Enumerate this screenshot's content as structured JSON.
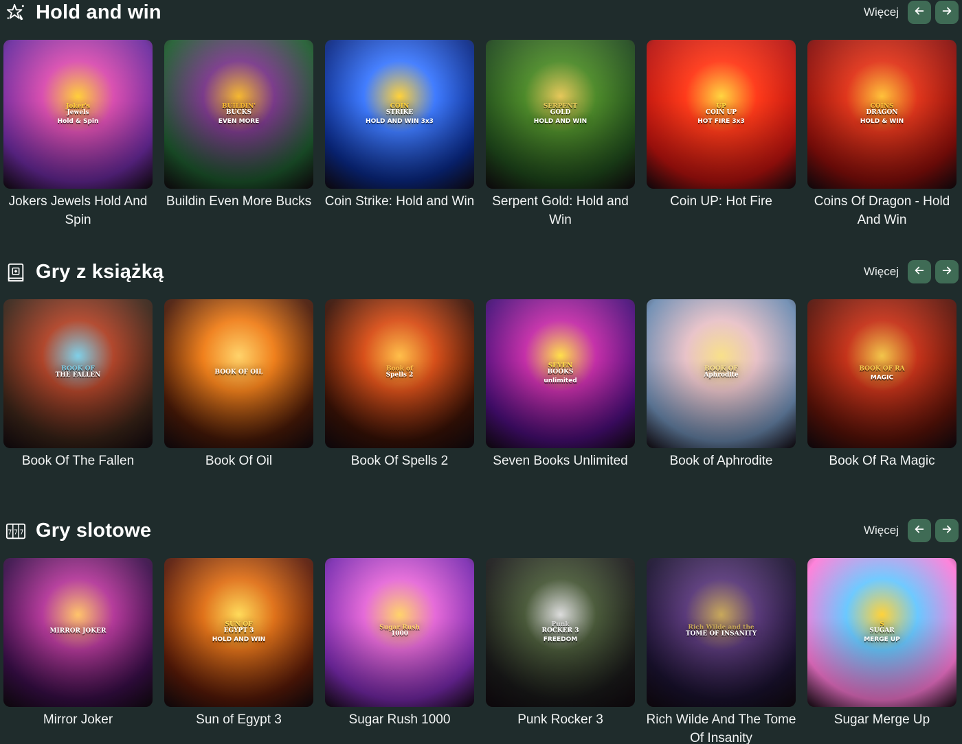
{
  "more_label": "Więcej",
  "sections": [
    {
      "title": "Hold and win",
      "icon": "star-sparkle-icon",
      "games": [
        {
          "title": "Jokers Jewels Hold And Spin",
          "logo": [
            "Joker's",
            "Jewels",
            "Hold & Spin"
          ],
          "colors": [
            "#6a2a9e",
            "#d94fb0",
            "#ffcf3a"
          ]
        },
        {
          "title": "Buildin Even More Bucks",
          "logo": [
            "BUILDIN'",
            "BUCKS",
            "EVEN MORE"
          ],
          "colors": [
            "#1d5a2e",
            "#7a3a8a",
            "#f5b830"
          ]
        },
        {
          "title": "Coin Strike: Hold and Win",
          "logo": [
            "COIN",
            "STRIKE",
            "HOLD AND WIN 3x3"
          ],
          "colors": [
            "#0a2a8a",
            "#3f7bff",
            "#ffd23a"
          ]
        },
        {
          "title": "Serpent Gold: Hold and Win",
          "logo": [
            "SERPENT",
            "GOLD",
            "HOLD AND WIN"
          ],
          "colors": [
            "#1f4a1c",
            "#4d8a2a",
            "#e6c85a"
          ]
        },
        {
          "title": "Coin UP: Hot Fire",
          "logo": [
            "UP",
            "COIN UP",
            "HOT FIRE 3x3"
          ],
          "colors": [
            "#b8120e",
            "#ff3a1a",
            "#ffd640"
          ]
        },
        {
          "title": "Coins Of Dragon - Hold And Win",
          "logo": [
            "COINS",
            "DRAGON",
            "HOLD & WIN"
          ],
          "colors": [
            "#8a0e0a",
            "#e0361c",
            "#ffc23a"
          ]
        }
      ]
    },
    {
      "title": "Gry z książką",
      "icon": "book-icon",
      "games": [
        {
          "title": "Book Of The Fallen",
          "logo": [
            "BOOK OF",
            "THE FALLEN",
            ""
          ],
          "colors": [
            "#3a2418",
            "#b0452a",
            "#7fd0e8"
          ]
        },
        {
          "title": "Book Of Oil",
          "logo": [
            "",
            "BOOK OF OIL",
            ""
          ],
          "colors": [
            "#4a1a08",
            "#f0801c",
            "#ffd36a"
          ]
        },
        {
          "title": "Book Of Spells 2",
          "logo": [
            "Book of",
            "Spells 2",
            ""
          ],
          "colors": [
            "#3a1206",
            "#d8501a",
            "#ffbf4a"
          ]
        },
        {
          "title": "Seven Books Unlimited",
          "logo": [
            "SEVEN",
            "BOOKS",
            "unlimited"
          ],
          "colors": [
            "#4a0e7a",
            "#c42fa8",
            "#ffe04a"
          ]
        },
        {
          "title": "Book of Aphrodite",
          "logo": [
            "BOOK OF",
            "Aphrodite",
            ""
          ],
          "colors": [
            "#6b8ab0",
            "#e8c2c8",
            "#f8e08a"
          ]
        },
        {
          "title": "Book Of Ra Magic",
          "logo": [
            "BOOK OF RA",
            "",
            "MAGIC"
          ],
          "colors": [
            "#5a1208",
            "#c5331a",
            "#f2c54a"
          ]
        }
      ]
    },
    {
      "title": "Gry slotowe",
      "icon": "slot-machine-icon",
      "games": [
        {
          "title": "Mirror Joker",
          "logo": [
            "",
            "MIRROR JOKER",
            ""
          ],
          "colors": [
            "#3a0e4a",
            "#b43a9a",
            "#ffc46a"
          ]
        },
        {
          "title": "Sun of Egypt 3",
          "logo": [
            "SUN OF",
            "EGYPT 3",
            "HOLD AND WIN"
          ],
          "colors": [
            "#5a1a08",
            "#e0721a",
            "#ffdb5a"
          ]
        },
        {
          "title": "Sugar Rush 1000",
          "logo": [
            "Sugar Rush",
            "1000",
            ""
          ],
          "colors": [
            "#7a2ab0",
            "#e56ad8",
            "#ffd36a"
          ]
        },
        {
          "title": "Punk Rocker 3",
          "logo": [
            "Punk",
            "ROCKER 3",
            "FREEDOM"
          ],
          "colors": [
            "#1a1a1a",
            "#4a5a3a",
            "#dcdcdc"
          ]
        },
        {
          "title": "Rich Wilde And The Tome Of Insanity",
          "logo": [
            "Rich Wilde and the",
            "TOME OF INSANITY",
            ""
          ],
          "colors": [
            "#1a1230",
            "#5a3a7a",
            "#c8a85a"
          ]
        },
        {
          "title": "Sugar Merge Up",
          "logo": [
            "S",
            "SUGAR",
            "MERGE UP"
          ],
          "colors": [
            "#ff7ad8",
            "#6ac8ff",
            "#ffd23a"
          ]
        }
      ]
    }
  ]
}
